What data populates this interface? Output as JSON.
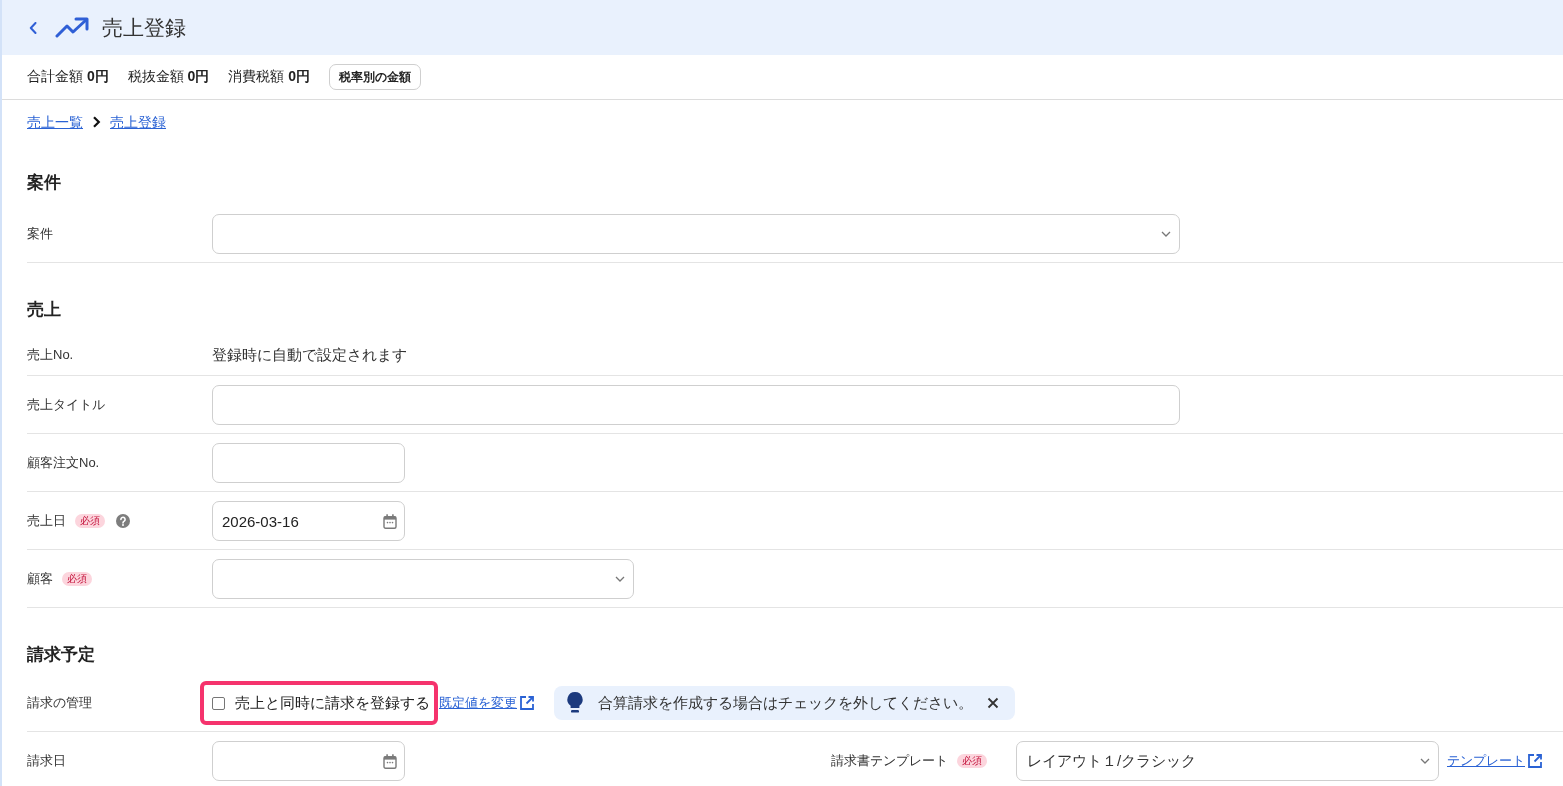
{
  "header": {
    "title": "売上登録"
  },
  "summary": {
    "totals": [
      "合計金額 **0円**",
      "税抜金額 **0円**",
      "消費税額 **0円**"
    ],
    "button": "税率別の金額"
  },
  "breadcrumb": [
    {
      "label": "売上一覧"
    },
    {
      "label": "売上登録"
    }
  ],
  "sections": [
    {
      "title": "案件",
      "rows": [
        {
          "label": "案件",
          "field": {
            "kind": "select"
          }
        }
      ]
    },
    {
      "title": "売上",
      "rows": [
        {
          "label": "売上No.",
          "field": {
            "kind": "static",
            "text": "登録時に自動で設定されます"
          }
        },
        {
          "label": "売上タイトル",
          "field": {
            "kind": "input"
          }
        },
        {
          "label": "顧客注文No.",
          "field": {
            "kind": "input"
          }
        },
        {
          "label": "売上日",
          "badge": "必須",
          "help": true,
          "field": {
            "kind": "date",
            "value": "2026-03-16"
          }
        },
        {
          "label": "顧客",
          "badge": "必須",
          "field": {
            "kind": "select"
          }
        }
      ]
    },
    {
      "title": "請求予定",
      "rows": [
        {
          "label": "請求の管理",
          "field": {
            "kind": "checkbox",
            "label": "売上と同時に請求を登録する",
            "checked": false,
            "highlighted": true
          },
          "link": "既定値を変更",
          "notice": "合算請求を作成する場合はチェックを外してください。"
        },
        {
          "label": "請求日",
          "field": {
            "kind": "date"
          },
          "side": {
            "label": "請求書テンプレート",
            "badge": "必須",
            "field": {
              "kind": "select",
              "value": "レイアウト１/クラシック"
            },
            "link": "テンプレート"
          }
        }
      ]
    }
  ]
}
